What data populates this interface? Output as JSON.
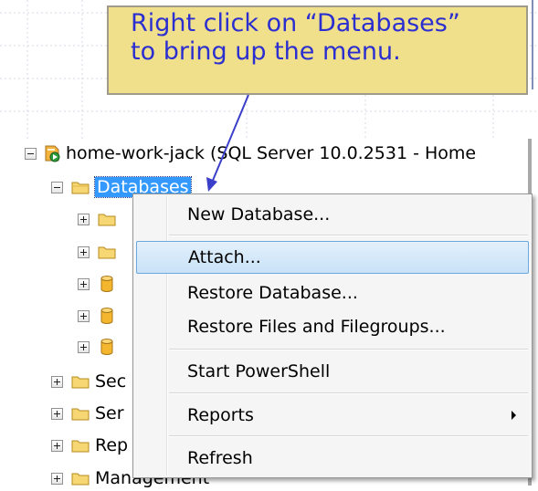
{
  "callout": {
    "line1": "Right click on “Databases”",
    "line2": "to bring up the menu."
  },
  "tree": {
    "server": {
      "label": "home-work-jack (SQL Server 10.0.2531 - Home",
      "icon": "server-icon"
    },
    "databases": {
      "label": "Databases",
      "icon": "folder-icon"
    },
    "children": [
      {
        "icon": "folder-icon"
      },
      {
        "icon": "folder-icon"
      },
      {
        "icon": "database-icon"
      },
      {
        "icon": "database-icon"
      },
      {
        "icon": "database-icon"
      }
    ],
    "siblings": [
      {
        "label": "Sec",
        "icon": "folder-icon"
      },
      {
        "label": "Ser",
        "icon": "folder-icon"
      },
      {
        "label": "Rep",
        "icon": "folder-icon"
      },
      {
        "label": "Management",
        "icon": "folder-icon"
      }
    ]
  },
  "context_menu": {
    "items": [
      {
        "label": "New Database..."
      },
      {
        "label": "Attach...",
        "highlighted": true
      },
      {
        "label": "Restore Database..."
      },
      {
        "label": "Restore Files and Filegroups..."
      },
      {
        "label": "Start PowerShell"
      },
      {
        "label": "Reports",
        "has_submenu": true
      },
      {
        "label": "Refresh"
      }
    ]
  },
  "colors": {
    "callout_bg": "#f0e08b",
    "callout_text": "#2b2fd0",
    "selection": "#3399ff",
    "menu_highlight": "#c9e2f8"
  }
}
